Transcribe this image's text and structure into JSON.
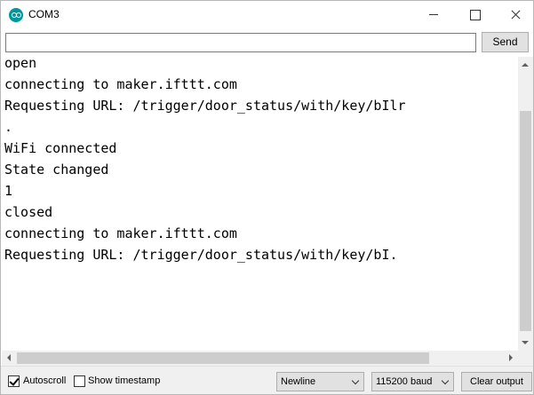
{
  "window": {
    "title": "COM3"
  },
  "input": {
    "value": "",
    "send_label": "Send"
  },
  "output": {
    "lines": [
      "open",
      "connecting to maker.ifttt.com",
      "Requesting URL: /trigger/door_status/with/key/bIlr",
      ".",
      "WiFi connected",
      "State changed",
      "1",
      "closed",
      "connecting to maker.ifttt.com",
      "Requesting URL: /trigger/door_status/with/key/bI."
    ]
  },
  "footer": {
    "autoscroll_label": "Autoscroll",
    "autoscroll_checked": true,
    "timestamp_label": "Show timestamp",
    "timestamp_checked": false,
    "line_ending": "Newline",
    "baud_rate": "115200 baud",
    "clear_label": "Clear output"
  },
  "colors": {
    "icon": "#00979c",
    "button_bg": "#e1e1e1",
    "bar_bg": "#f0f0f0"
  }
}
